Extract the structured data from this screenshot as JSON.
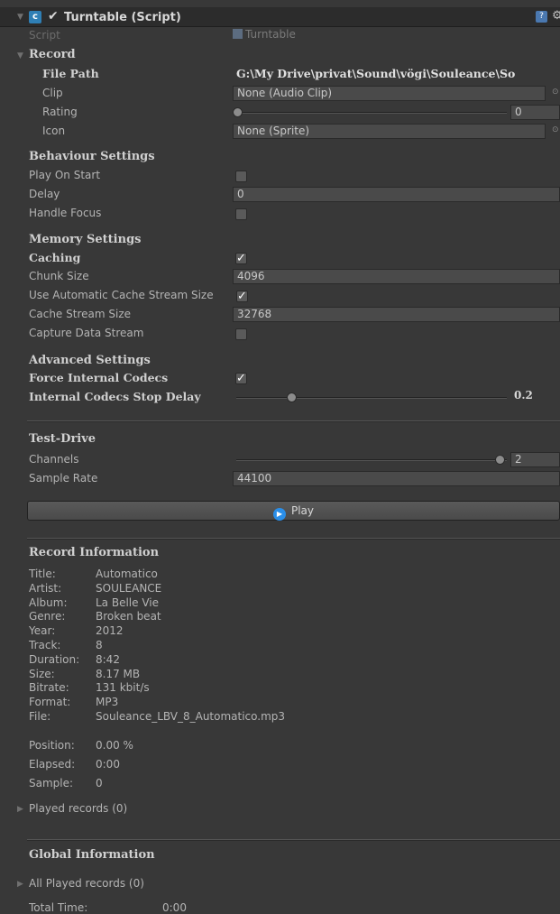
{
  "header": {
    "title": "Turntable (Script)",
    "script_label": "Script",
    "script_value": "Turntable"
  },
  "record": {
    "title": "Record",
    "file_path_label": "File Path",
    "file_path_value": "G:\\My Drive\\privat\\Sound\\vögi\\Souleance\\So",
    "clip_label": "Clip",
    "clip_value": "None (Audio Clip)",
    "rating_label": "Rating",
    "rating_value": "0",
    "icon_label": "Icon",
    "icon_value": "None (Sprite)"
  },
  "behaviour": {
    "title": "Behaviour Settings",
    "play_on_start_label": "Play On Start",
    "play_on_start": false,
    "delay_label": "Delay",
    "delay_value": "0",
    "handle_focus_label": "Handle Focus",
    "handle_focus": false
  },
  "memory": {
    "title": "Memory Settings",
    "caching_label": "Caching",
    "caching": true,
    "chunk_size_label": "Chunk Size",
    "chunk_size_value": "4096",
    "auto_cache_label": "Use Automatic Cache Stream Size",
    "auto_cache": true,
    "cache_stream_label": "Cache Stream Size",
    "cache_stream_value": "32768",
    "capture_label": "Capture Data Stream",
    "capture": false
  },
  "advanced": {
    "title": "Advanced Settings",
    "force_codecs_label": "Force Internal Codecs",
    "force_codecs": true,
    "stop_delay_label": "Internal Codecs Stop Delay",
    "stop_delay_value": "0.2",
    "stop_delay_fraction": 0.2
  },
  "test_drive": {
    "title": "Test-Drive",
    "channels_label": "Channels",
    "channels_value": "2",
    "channels_fraction": 1.0,
    "sample_rate_label": "Sample Rate",
    "sample_rate_value": "44100",
    "play_label": "Play"
  },
  "record_info": {
    "title": "Record Information",
    "rows": [
      {
        "k": "Title:",
        "v": "Automatico"
      },
      {
        "k": "Artist:",
        "v": "SOULEANCE"
      },
      {
        "k": "Album:",
        "v": "La Belle Vie"
      },
      {
        "k": "Genre:",
        "v": "Broken beat"
      },
      {
        "k": "Year:",
        "v": "2012"
      },
      {
        "k": "Track:",
        "v": "8"
      },
      {
        "k": "Duration:",
        "v": "8:42"
      },
      {
        "k": "Size:",
        "v": "8.17 MB"
      },
      {
        "k": "Bitrate:",
        "v": "131 kbit/s"
      },
      {
        "k": "Format:",
        "v": "MP3"
      },
      {
        "k": "File:",
        "v": "Souleance_LBV_8_Automatico.mp3"
      }
    ],
    "position_label": "Position:",
    "position_value": "0.00 %",
    "elapsed_label": "Elapsed:",
    "elapsed_value": "0:00",
    "sample_label": "Sample:",
    "sample_value": "0",
    "played_records": "Played records (0)"
  },
  "global_info": {
    "title": "Global Information",
    "all_played": "All Played records (0)",
    "total_time_label": "Total Time:",
    "total_time_value": "0:00"
  }
}
